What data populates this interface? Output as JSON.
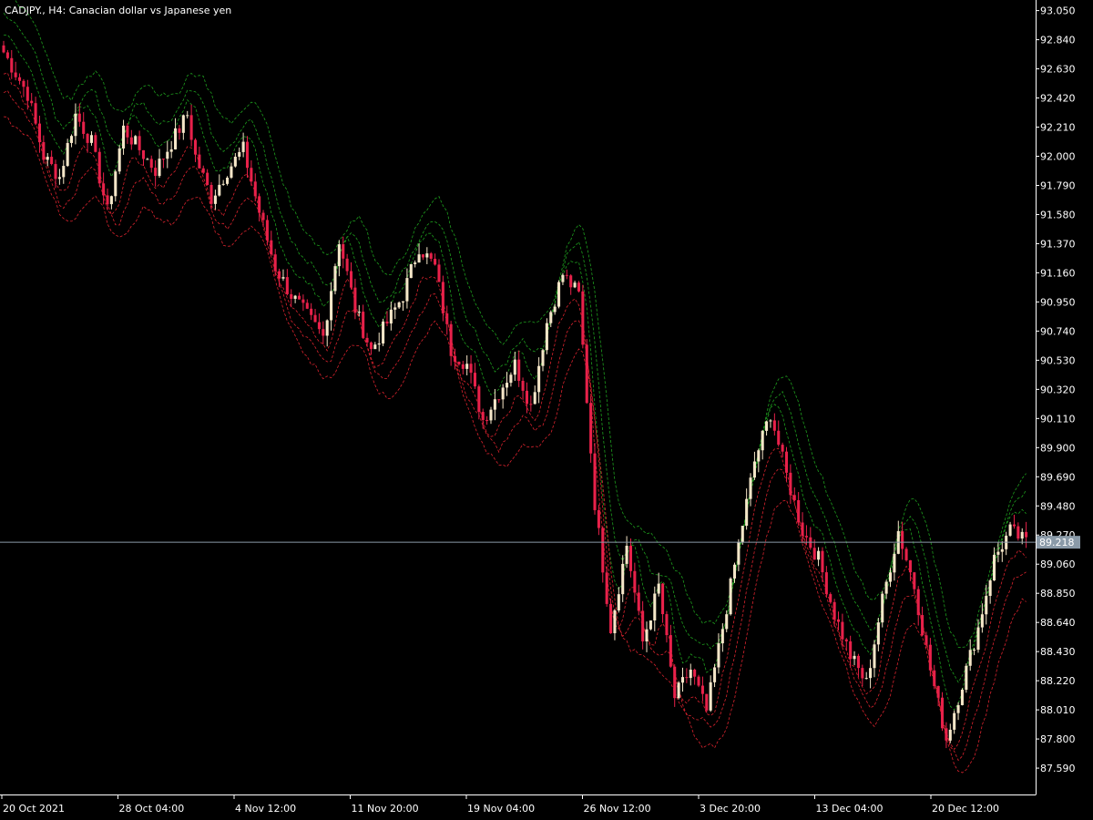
{
  "chart_header": {
    "title": "CADJPY., H4:  Canacian dollar vs Japanese yen"
  },
  "colors": {
    "background": "#000000",
    "axis": "#ffffff",
    "bull_candle": "#f5e6c8",
    "bear_candle": "#e8214a",
    "upper_bands": "#1e9e1e",
    "lower_bands": "#d9232e",
    "price_line": "#8a9aa8",
    "price_label_bg": "#8a9aa8"
  },
  "chart_data": {
    "type": "candlestick",
    "symbol": "CADJPY.",
    "timeframe": "H4",
    "ylim": [
      87.4,
      93.1
    ],
    "y_ticks": [
      "93.050",
      "92.840",
      "92.630",
      "92.420",
      "92.210",
      "92.000",
      "91.790",
      "91.580",
      "91.370",
      "91.160",
      "90.950",
      "90.740",
      "90.530",
      "90.320",
      "90.110",
      "89.900",
      "89.690",
      "89.480",
      "89.270",
      "89.060",
      "88.850",
      "88.640",
      "88.430",
      "88.220",
      "88.010",
      "87.800",
      "87.590"
    ],
    "x_ticks": [
      "20 Oct 2021",
      "28 Oct 04:00",
      "4 Nov 12:00",
      "11 Nov 20:00",
      "19 Nov 04:00",
      "26 Nov 12:00",
      "3 Dec 20:00",
      "13 Dec 04:00",
      "20 Dec 12:00"
    ],
    "current_price": "89.218",
    "close_path": [
      [
        0,
        92.75
      ],
      [
        6,
        92.45
      ],
      [
        10,
        92.0
      ],
      [
        14,
        91.85
      ],
      [
        18,
        92.3
      ],
      [
        22,
        92.1
      ],
      [
        26,
        91.6
      ],
      [
        30,
        92.2
      ],
      [
        34,
        92.05
      ],
      [
        38,
        91.9
      ],
      [
        42,
        92.1
      ],
      [
        46,
        92.3
      ],
      [
        48,
        92.0
      ],
      [
        52,
        91.7
      ],
      [
        56,
        91.9
      ],
      [
        60,
        92.05
      ],
      [
        64,
        91.6
      ],
      [
        68,
        91.2
      ],
      [
        72,
        91.0
      ],
      [
        76,
        90.85
      ],
      [
        80,
        90.7
      ],
      [
        84,
        91.4
      ],
      [
        88,
        90.9
      ],
      [
        92,
        90.6
      ],
      [
        96,
        90.8
      ],
      [
        100,
        91.0
      ],
      [
        104,
        91.35
      ],
      [
        108,
        91.2
      ],
      [
        112,
        90.6
      ],
      [
        116,
        90.5
      ],
      [
        120,
        90.1
      ],
      [
        124,
        90.3
      ],
      [
        128,
        90.5
      ],
      [
        132,
        90.2
      ],
      [
        136,
        90.8
      ],
      [
        140,
        91.15
      ],
      [
        144,
        91.0
      ],
      [
        148,
        89.5
      ],
      [
        152,
        88.6
      ],
      [
        156,
        89.2
      ],
      [
        160,
        88.5
      ],
      [
        164,
        88.9
      ],
      [
        168,
        88.1
      ],
      [
        172,
        88.3
      ],
      [
        176,
        88.0
      ],
      [
        180,
        88.6
      ],
      [
        184,
        89.2
      ],
      [
        188,
        89.8
      ],
      [
        192,
        90.15
      ],
      [
        196,
        89.7
      ],
      [
        200,
        89.3
      ],
      [
        204,
        89.1
      ],
      [
        208,
        88.7
      ],
      [
        212,
        88.4
      ],
      [
        216,
        88.2
      ],
      [
        220,
        88.8
      ],
      [
        224,
        89.3
      ],
      [
        228,
        88.9
      ],
      [
        232,
        88.3
      ],
      [
        236,
        87.8
      ],
      [
        240,
        88.2
      ],
      [
        244,
        88.6
      ],
      [
        248,
        89.1
      ],
      [
        252,
        89.3
      ],
      [
        256,
        89.218
      ]
    ]
  }
}
